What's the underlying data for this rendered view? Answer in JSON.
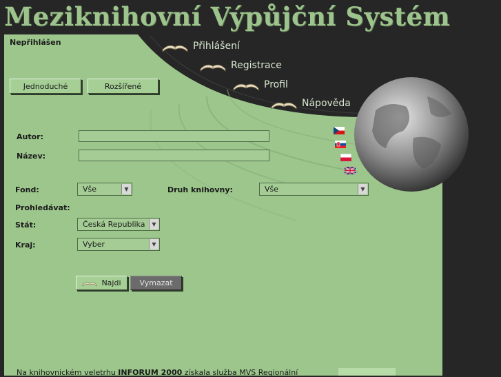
{
  "header": {
    "title": "Meziknihovní Výpůjční Systém"
  },
  "status": {
    "login": "Nepřihlášen"
  },
  "nav": [
    {
      "label": "Přihlášení",
      "icon": "open-book-icon"
    },
    {
      "label": "Registrace",
      "icon": "open-book-icon"
    },
    {
      "label": "Profil",
      "icon": "open-book-icon"
    },
    {
      "label": "Nápověda",
      "icon": "open-book-icon"
    }
  ],
  "modes": {
    "simple": "Jednoduché",
    "advanced": "Rozšířené"
  },
  "form": {
    "author_label": "Autor:",
    "author_value": "",
    "title_label": "Název:",
    "title_value": "",
    "fond_label": "Fond:",
    "fond_value": "Vše",
    "library_type_label": "Druh knihovny:",
    "library_type_value": "Vše",
    "search_label": "Prohledávat:",
    "state_label": "Stát:",
    "state_value": "Česká Republika",
    "region_label": "Kraj:",
    "region_value": "Vyber"
  },
  "languages": [
    "czech-flag",
    "slovak-flag",
    "polish-flag",
    "english-flag"
  ],
  "buttons": {
    "find": "Najdi",
    "clear": "Vymazat"
  },
  "footer": {
    "text_before": "Na knihovnickém veletrhu ",
    "highlight": "INFORUM 2000",
    "text_after": " získala služba MVS Regionální"
  },
  "colors": {
    "panel": "#9cc68c",
    "background": "#262626",
    "title": "#9dc48c"
  }
}
